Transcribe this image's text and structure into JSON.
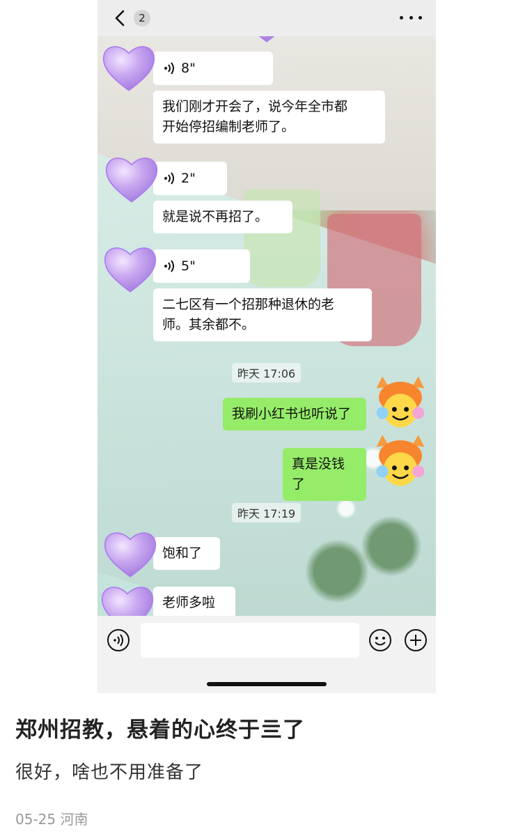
{
  "chat": {
    "back_badge": "2",
    "messages": [
      {
        "type": "voice",
        "duration": "8\""
      },
      {
        "type": "text",
        "lines": [
          "我们刚才开会了，说今年全市都",
          "开始停招编制老师了。"
        ]
      },
      {
        "type": "voice",
        "duration": "2\""
      },
      {
        "type": "text",
        "lines": [
          "就是说不再招了。"
        ]
      },
      {
        "type": "voice",
        "duration": "5\""
      },
      {
        "type": "text",
        "lines": [
          "二七区有一个招那种退休的老",
          "师。其余都不。"
        ]
      },
      {
        "type": "time",
        "text": "昨天 17:06"
      },
      {
        "type": "sent",
        "text": "我刷小红书也听说了"
      },
      {
        "type": "sent",
        "text": "真是没钱了"
      },
      {
        "type": "time",
        "text": "昨天 17:19"
      },
      {
        "type": "text",
        "lines": [
          "饱和了"
        ]
      },
      {
        "type": "text",
        "lines": [
          "老师多啦"
        ]
      }
    ]
  },
  "post": {
    "title": "郑州招教，悬着的心终于亖了",
    "body": "很好，啥也不用准备了",
    "meta": "05-25 河南"
  },
  "colors": {
    "sent_bubble": "#95ec69",
    "received_bubble": "#ffffff",
    "heart": "#c9a8f0"
  }
}
